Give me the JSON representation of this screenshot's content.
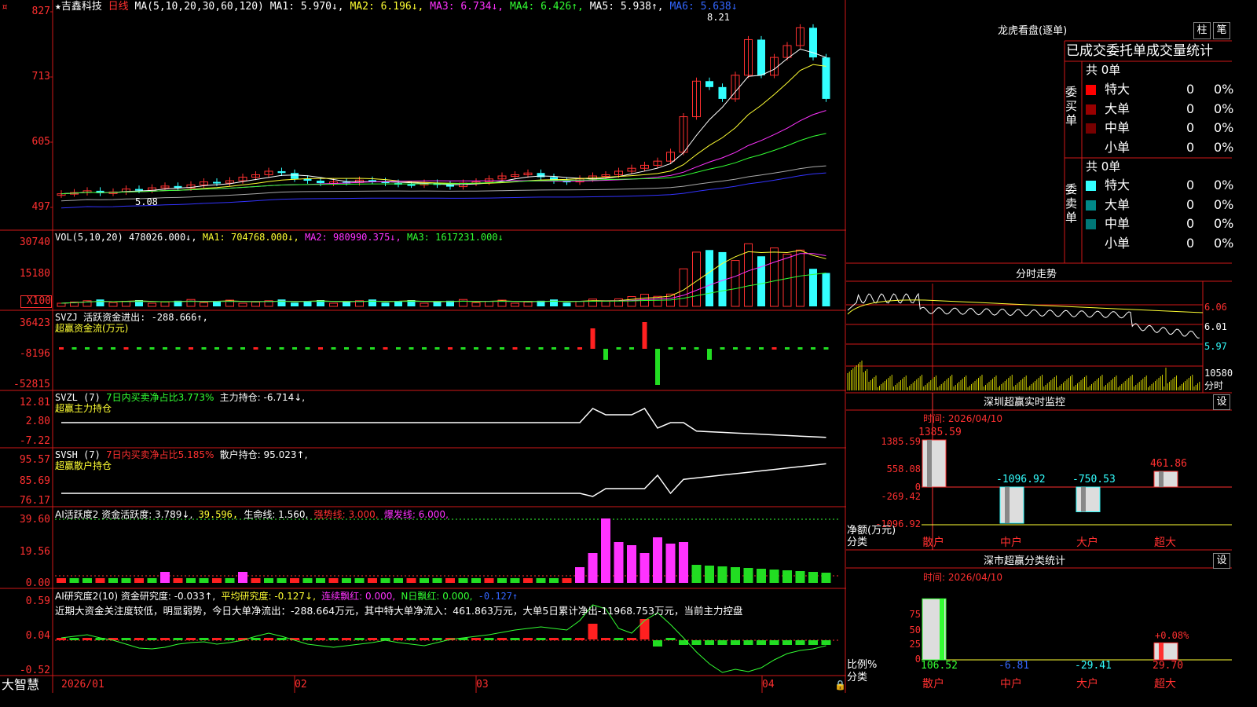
{
  "header": {
    "star": "★",
    "stock_name": "吉鑫科技",
    "period": "日线",
    "ma_params": "MA(5,10,20,30,60,120)",
    "ma1": "MA1: 5.970↓,",
    "ma2": "MA2: 6.196↓,",
    "ma3": "MA3: 6.734↓,",
    "ma4": "MA4: 6.426↑,",
    "ma5": "MA5: 5.938↑,",
    "ma6": "MA6: 5.638↓",
    "high_label": "8.21",
    "low_label": "5.08"
  },
  "price_axis": [
    "827",
    "713",
    "605",
    "497"
  ],
  "vol": {
    "title": "VOL(5,10,20)",
    "value": "478026.000↓,",
    "ma1": "MA1: 704768.000↓,",
    "ma2": "MA2: 980990.375↓,",
    "ma3": "MA3: 1617231.000↓",
    "axis": [
      "30740",
      "15180",
      "X100"
    ]
  },
  "svzj": {
    "title": "SVZJ  活跃资金进出: -288.666↑,",
    "subtitle": "超赢资金流(万元)",
    "axis": [
      "36423",
      "-8196",
      "-52815"
    ]
  },
  "svzl": {
    "title": "SVZL (7)",
    "ratio": "7日内买卖净占比3.773%",
    "hold": "主力持仓: -6.714↓,",
    "subtitle": "超赢主力持仓",
    "axis": [
      "12.81",
      "2.80",
      "-7.22"
    ]
  },
  "svsh": {
    "title": "SVSH (7)",
    "ratio": "7日内买卖净占比5.185%",
    "hold": "散户持仓: 95.023↑,",
    "subtitle": "超赢散户持仓",
    "axis": [
      "95.57",
      "85.69",
      "76.17"
    ]
  },
  "ai1": {
    "title": "AI活跃度2 资金活跃度: 3.789↓,",
    "v2": "39.596,",
    "v3": "生命线: 1.560,",
    "v4": "强势线: 3.000,",
    "v5": "爆发线: 6.000,",
    "axis": [
      "39.60",
      "19.56",
      "0.00"
    ]
  },
  "ai2": {
    "title": "AI研究度2(10) 资金研究度: -0.033↑,",
    "v2": "平均研究度: -0.127↓,",
    "v3": "连续飘红: 0.000,",
    "v4": "N日飘红: 0.000,",
    "v5": "-0.127↑",
    "comment": "近期大资金关注度较低，明显弱势，今日大单净流出：-288.664万元，其中特大单净流入：461.863万元，大单5日累计净出-11968.753万元，当前主力控盘",
    "axis": [
      "0.59",
      "0.04",
      "-0.52"
    ]
  },
  "x_axis": [
    "2026/01",
    "02",
    "03",
    "04"
  ],
  "bottom_left": "大智慧",
  "right": {
    "dragon_title": "龙虎看盘(逐单)",
    "btn_zhu": "柱",
    "btn_bi": "笔",
    "tab_title": "已成交委托单成交量统计",
    "buy_label": "委买单",
    "sell_label": "委卖单",
    "buy_total": "共 0单",
    "sell_total": "共 0单",
    "buy_rows": [
      {
        "name": "特大",
        "v": "0",
        "p": "0%",
        "color": "#ff0000"
      },
      {
        "name": "大单",
        "v": "0",
        "p": "0%",
        "color": "#990000"
      },
      {
        "name": "中单",
        "v": "0",
        "p": "0%",
        "color": "#770000"
      },
      {
        "name": "小单",
        "v": "0",
        "p": "0%",
        "color": "#000000"
      }
    ],
    "sell_rows": [
      {
        "name": "特大",
        "v": "0",
        "p": "0%",
        "color": "#33ffff"
      },
      {
        "name": "大单",
        "v": "0",
        "p": "0%",
        "color": "#008888"
      },
      {
        "name": "中单",
        "v": "0",
        "p": "0%",
        "color": "#007777"
      },
      {
        "name": "小单",
        "v": "0",
        "p": "0%",
        "color": "#000000"
      }
    ],
    "intraday_title": "分时走势",
    "intraday_axis": [
      "6.06",
      "6.01",
      "5.97",
      "10580",
      "分时"
    ],
    "monitor_title": "深圳超赢实时监控",
    "monitor_btn": "设",
    "monitor_time": "时间: 2026/04/10",
    "monitor_axis": [
      "1385.59",
      "558.08",
      "0",
      "-269.42",
      "-1096.92"
    ],
    "monitor_ylabel": "净额(万元)",
    "monitor_xlabel": "分类",
    "monitor_bars": [
      {
        "cat": "散户",
        "label": "1385.59",
        "value": 1385.59
      },
      {
        "cat": "中户",
        "label": "-1096.92",
        "value": -1096.92
      },
      {
        "cat": "大户",
        "label": "-750.53",
        "value": -750.53
      },
      {
        "cat": "超大",
        "label": "461.86",
        "value": 461.86
      }
    ],
    "stat_title": "深市超赢分类统计",
    "stat_btn": "设",
    "stat_time": "时间: 2026/04/10",
    "stat_axis": [
      "75",
      "50",
      "25",
      "0"
    ],
    "stat_ylabel": "比例%",
    "stat_xlabel": "分类",
    "stat_pct_label": "+0.08%",
    "stat_bars": [
      {
        "cat": "散户",
        "label": "106.52",
        "value": 106.52
      },
      {
        "cat": "中户",
        "label": "-6.81",
        "value": -6.81
      },
      {
        "cat": "大户",
        "label": "-29.41",
        "value": -29.41
      },
      {
        "cat": "超大",
        "label": "29.70",
        "value": 29.7
      }
    ]
  },
  "chart_data": {
    "type": "bar",
    "categories": [
      "散户",
      "中户",
      "大户",
      "超大"
    ],
    "values": [
      1385.59,
      -1096.92,
      -750.53,
      461.86
    ],
    "title": "深圳超赢实时监控",
    "xlabel": "分类",
    "ylabel": "净额(万元)",
    "ylim": [
      -1096.92,
      1385.59
    ]
  }
}
